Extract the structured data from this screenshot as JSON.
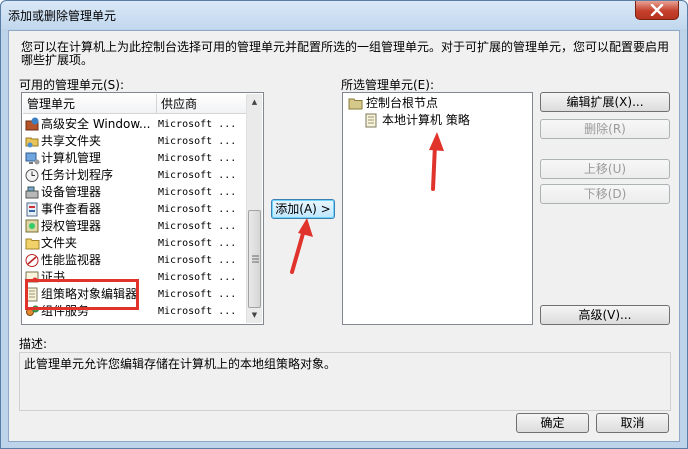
{
  "window": {
    "title": "添加或删除管理单元",
    "close_symbol": "✕"
  },
  "description_top": "您可以在计算机上为此控制台选择可用的管理单元并配置所选的一组管理单元。对于可扩展的管理单元，您可以配置要启用哪些扩展项。",
  "available": {
    "label": "可用的管理单元(S):",
    "columns": [
      "管理单元",
      "供应商"
    ],
    "items": [
      {
        "name": "高级安全 Window...",
        "vendor": "Microsoft ...",
        "icon": "firewall-icon"
      },
      {
        "name": "共享文件夹",
        "vendor": "Microsoft ...",
        "icon": "shared-folder-icon"
      },
      {
        "name": "计算机管理",
        "vendor": "Microsoft ...",
        "icon": "computer-management-icon"
      },
      {
        "name": "任务计划程序",
        "vendor": "Microsoft ...",
        "icon": "clock-icon"
      },
      {
        "name": "设备管理器",
        "vendor": "Microsoft ...",
        "icon": "device-manager-icon"
      },
      {
        "name": "事件查看器",
        "vendor": "Microsoft ...",
        "icon": "event-viewer-icon"
      },
      {
        "name": "授权管理器",
        "vendor": "Microsoft ...",
        "icon": "authorization-icon"
      },
      {
        "name": "文件夹",
        "vendor": "Microsoft ...",
        "icon": "folder-icon"
      },
      {
        "name": "性能监视器",
        "vendor": "Microsoft ...",
        "icon": "performance-icon"
      },
      {
        "name": "证书",
        "vendor": "Microsoft ...",
        "icon": "certificate-icon"
      },
      {
        "name": "组策略对象编辑器",
        "vendor": "Microsoft ...",
        "icon": "policy-icon"
      },
      {
        "name": "组件服务",
        "vendor": "Microsoft ...",
        "icon": "component-services-icon"
      }
    ]
  },
  "selected": {
    "label": "所选管理单元(E):",
    "root": "控制台根节点",
    "child": "本地计算机 策略"
  },
  "buttons": {
    "add": "添加(A) >",
    "edit_extensions": "编辑扩展(X)...",
    "remove": "删除(R)",
    "move_up": "上移(U)",
    "move_down": "下移(D)",
    "advanced": "高级(V)...",
    "ok": "确定",
    "cancel": "取消"
  },
  "description": {
    "label": "描述:",
    "text": "此管理单元允许您编辑存储在计算机上的本地组策略对象。"
  },
  "colors": {
    "annotation_red": "#e0332c",
    "title_bar": "#c2d8ee",
    "close_button": "#c5412d"
  }
}
